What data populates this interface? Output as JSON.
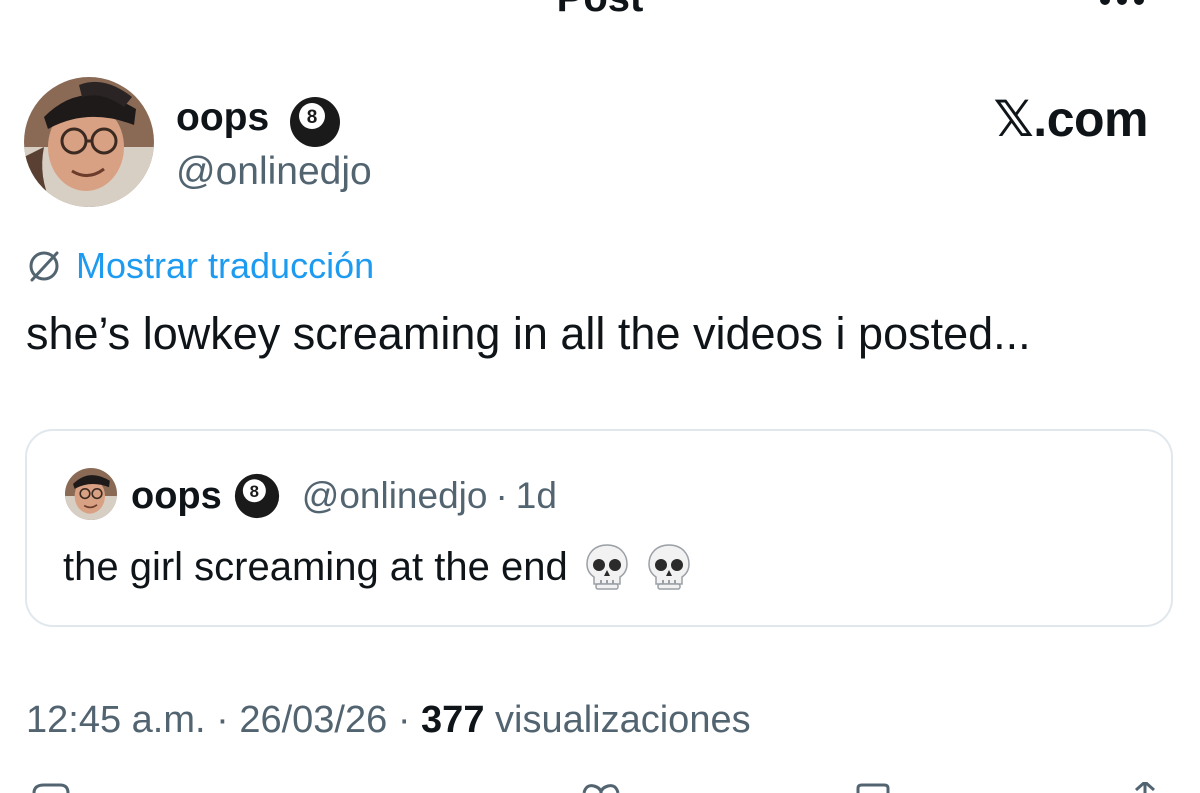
{
  "header": {
    "title": "Post"
  },
  "author": {
    "name": "oops",
    "handle": "@onlinedjo",
    "badge_icon": "8-ball-icon"
  },
  "brand": {
    "label": "𝕏.com"
  },
  "translate": {
    "label": "Mostrar traducción",
    "icon": "globe-icon",
    "color": "#1d9bf0"
  },
  "tweet": {
    "text": "she’s lowkey screaming in all the videos i posted..."
  },
  "quote": {
    "name": "oops",
    "handle": "@onlinedjo",
    "separator": "·",
    "time": "1d",
    "text": "the girl screaming at the end",
    "emoji_icons": [
      "skull-icon",
      "skull-icon"
    ]
  },
  "meta": {
    "time": "12:45 a.m.",
    "sep1": " · ",
    "date": "26/03/26",
    "sep2": " · ",
    "views_count": "377",
    "views_label": " visualizaciones"
  },
  "colors": {
    "text": "#0f1419",
    "secondary": "#536471",
    "border": "#e1e8ed",
    "link": "#1d9bf0"
  }
}
